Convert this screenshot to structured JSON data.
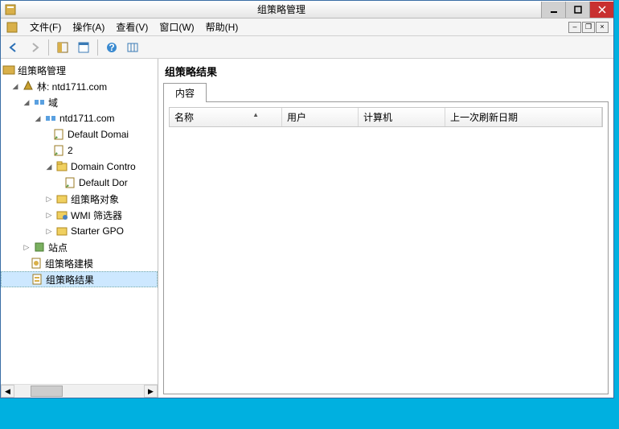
{
  "window": {
    "title": "组策略管理"
  },
  "menu": {
    "file": "文件(F)",
    "action": "操作(A)",
    "view": "查看(V)",
    "window": "窗口(W)",
    "help": "帮助(H)"
  },
  "tree": {
    "root": "组策略管理",
    "forest": "林: ntd1711.com",
    "domains": "域",
    "domain1": "ntd1711.com",
    "default_domain": "Default Domai",
    "item2": "2",
    "domain_controllers": "Domain Contro",
    "default_dc": "Default Dor",
    "gpo_objects": "组策略对象",
    "wmi_filters": "WMI 筛选器",
    "starter_gpo": "Starter GPO",
    "sites": "站点",
    "modeling": "组策略建模",
    "results": "组策略结果"
  },
  "content": {
    "title": "组策略结果",
    "tab1": "内容",
    "columns": {
      "name": "名称",
      "user": "用户",
      "computer": "计算机",
      "last_refresh": "上一次刷新日期"
    }
  }
}
